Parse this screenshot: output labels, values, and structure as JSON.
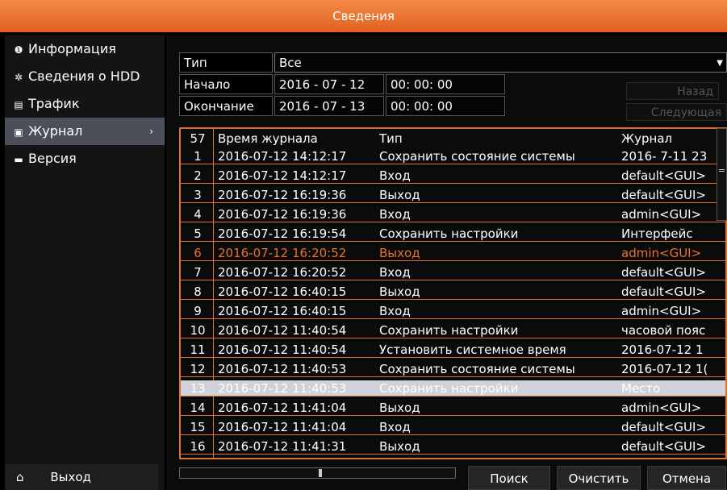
{
  "title": "Сведения",
  "sidebar": {
    "items": [
      {
        "icon": "info-icon",
        "glyph": "❶",
        "label": "Информация"
      },
      {
        "icon": "hdd-icon",
        "glyph": "✲",
        "label": "Сведения о HDD"
      },
      {
        "icon": "traffic-icon",
        "glyph": "▤",
        "label": "Трафик"
      },
      {
        "icon": "log-icon",
        "glyph": "▣",
        "label": "Журнал"
      },
      {
        "icon": "version-icon",
        "glyph": "▬",
        "label": "Версия"
      }
    ],
    "active_index": 3,
    "logout_label": "Выход"
  },
  "filters": {
    "type_label": "Тип",
    "type_value": "Все",
    "start_label": "Начало",
    "start_date": "2016 - 07 - 12",
    "start_time": "00: 00: 00",
    "end_label": "Окончание",
    "end_date": "2016 - 07 - 13",
    "end_time": "00: 00: 00"
  },
  "nav": {
    "prev_label": "Назад",
    "next_label": "Следующая"
  },
  "log": {
    "headers": {
      "count": "57",
      "time": "Время журнала",
      "type": "Тип",
      "journal": "Журнал"
    },
    "rows": [
      {
        "n": "1",
        "time": "2016-07-12 14:12:17",
        "type": "Сохранить состояние системы",
        "journal": "2016- 7-11 23"
      },
      {
        "n": "2",
        "time": "2016-07-12 14:12:17",
        "type": "Вход",
        "journal": "default<GUI>"
      },
      {
        "n": "3",
        "time": "2016-07-12 16:19:36",
        "type": "Выход",
        "journal": "default<GUI>"
      },
      {
        "n": "4",
        "time": "2016-07-12 16:19:36",
        "type": "Вход",
        "journal": "admin<GUI>"
      },
      {
        "n": "5",
        "time": "2016-07-12 16:19:54",
        "type": "Сохранить настройки",
        "journal": "Интерфейс"
      },
      {
        "n": "6",
        "time": "2016-07-12 16:20:52",
        "type": "Выход",
        "journal": "admin<GUI>"
      },
      {
        "n": "7",
        "time": "2016-07-12 16:20:52",
        "type": "Вход",
        "journal": "default<GUI>"
      },
      {
        "n": "8",
        "time": "2016-07-12 16:40:15",
        "type": "Выход",
        "journal": "default<GUI>"
      },
      {
        "n": "9",
        "time": "2016-07-12 16:40:15",
        "type": "Вход",
        "journal": "admin<GUI>"
      },
      {
        "n": "10",
        "time": "2016-07-12 11:40:54",
        "type": "Сохранить настройки",
        "journal": "часовой пояс"
      },
      {
        "n": "11",
        "time": "2016-07-12 11:40:54",
        "type": "Установить системное время",
        "journal": "2016-07-12 1"
      },
      {
        "n": "12",
        "time": "2016-07-12 11:40:53",
        "type": "Сохранить состояние системы",
        "journal": "2016-07-12 1("
      },
      {
        "n": "13",
        "time": "2016-07-12 11:40:53",
        "type": "Сохранить настройки",
        "journal": "Место"
      },
      {
        "n": "14",
        "time": "2016-07-12 11:41:04",
        "type": "Выход",
        "journal": "admin<GUI>"
      },
      {
        "n": "15",
        "time": "2016-07-12 11:41:04",
        "type": "Вход",
        "journal": "default<GUI>"
      },
      {
        "n": "16",
        "time": "2016-07-12 11:41:31",
        "type": "Выход",
        "journal": "default<GUI>"
      }
    ],
    "selected_row": "6",
    "highlighted_row": "13"
  },
  "buttons": {
    "search": "Поиск",
    "clear": "Очистить",
    "cancel": "Отмена"
  },
  "colors": {
    "accent": "#e5742f",
    "titlebar": "#e8702e",
    "highlight_row": "#cfd2d8"
  }
}
